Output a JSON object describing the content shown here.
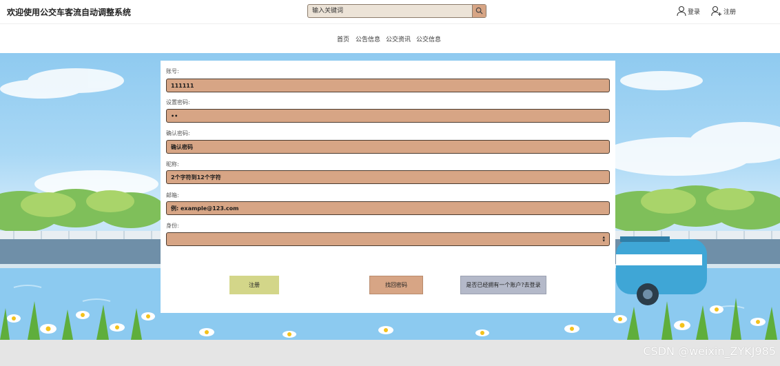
{
  "header": {
    "site_title": "欢迎使用公交车客流自动调整系统",
    "search_placeholder": "输入关键词",
    "login_label": "登录",
    "register_label": "注册"
  },
  "nav": {
    "items": [
      {
        "label": "首页"
      },
      {
        "label": "公告信息"
      },
      {
        "label": "公交资讯"
      },
      {
        "label": "公交信息"
      }
    ]
  },
  "form": {
    "account": {
      "label": "账号:",
      "value": "111111"
    },
    "password": {
      "label": "设置密码:",
      "value": "••"
    },
    "confirm_password": {
      "label": "确认密码:",
      "placeholder": "确认密码"
    },
    "nickname": {
      "label": "昵称:",
      "placeholder": "2个字符到12个字符"
    },
    "email": {
      "label": "邮箱:",
      "placeholder": "例: example@123.com"
    },
    "identity": {
      "label": "身份:",
      "value": ""
    }
  },
  "buttons": {
    "register": "注册",
    "retrieve_password": "找回密码",
    "go_login": "是否已经拥有一个账户?去登录"
  },
  "watermark": "CSDN @weixin_ZYKJ985",
  "colors": {
    "field_bg": "#d7a585",
    "register_btn": "#d3d689",
    "retrieve_btn": "#d7a585",
    "login_btn": "#b4b9c9"
  }
}
